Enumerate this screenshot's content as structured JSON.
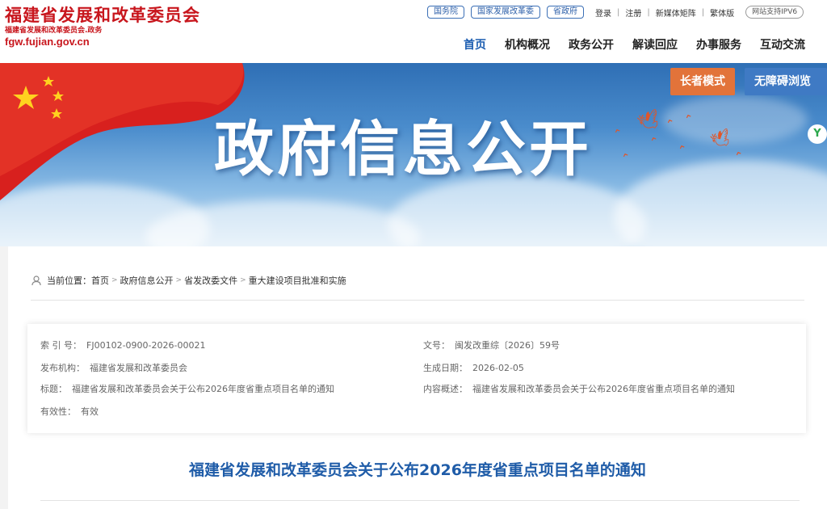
{
  "header": {
    "logo_main": "福建省发展和改革委员会",
    "logo_sub": "福建省发展和改革委员会.政务",
    "logo_domain": "fgw.fujian.gov.cn",
    "top_pills": [
      "国务院",
      "国家发展改革委",
      "省政府"
    ],
    "util_links": [
      "登录",
      "注册",
      "新媒体矩阵",
      "繁体版"
    ],
    "ipv6_badge": "网站支持IPV6",
    "nav": [
      "首页",
      "机构概况",
      "政务公开",
      "解读回应",
      "办事服务",
      "互动交流"
    ],
    "nav_active": "首页"
  },
  "banner": {
    "title": "政府信息公开",
    "elder_mode": "长者模式",
    "accessible": "无障碍浏览",
    "float_icon_text": "Y"
  },
  "breadcrumb": {
    "prefix": "当前位置：",
    "items": [
      "首页",
      "政府信息公开",
      "省发改委文件",
      "重大建设项目批准和实施"
    ]
  },
  "meta": {
    "index_label": "索 引 号：",
    "index_value": "FJ00102-0900-2026-00021",
    "docno_label": "文号：",
    "docno_value": "闽发改重综〔2026〕59号",
    "org_label": "发布机构：",
    "org_value": "福建省发展和改革委员会",
    "date_label": "生成日期：",
    "date_value": "2026-02-05",
    "title_label": "标题：",
    "title_value": "福建省发展和改革委员会关于公布2026年度省重点项目名单的通知",
    "summary_label": "内容概述：",
    "summary_value": "福建省发展和改革委员会关于公布2026年度省重点项目名单的通知",
    "validity_label": "有效性：",
    "validity_value": "有效"
  },
  "document": {
    "title": "福建省发展和改革委员会关于公布2026年度省重点项目名单的通知"
  },
  "colors": {
    "brand_red": "#c8161d",
    "link_blue": "#1f5ca8",
    "elder_orange": "#e2733a",
    "access_blue": "#3f7ac4"
  }
}
